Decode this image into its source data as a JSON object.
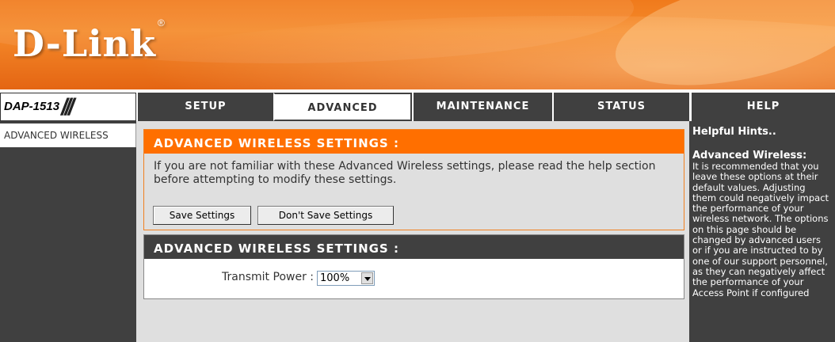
{
  "brand": {
    "logo_text": "D-Link",
    "reg_mark": "®",
    "model": "DAP-1513",
    "model_slashes": "///"
  },
  "nav": {
    "tabs": [
      {
        "label": "SETUP",
        "active": false
      },
      {
        "label": "ADVANCED",
        "active": true
      },
      {
        "label": "MAINTENANCE",
        "active": false
      },
      {
        "label": "STATUS",
        "active": false
      },
      {
        "label": "HELP",
        "active": false
      }
    ]
  },
  "sidebar": {
    "items": [
      {
        "label": "ADVANCED WIRELESS"
      }
    ]
  },
  "main": {
    "section1": {
      "title": "ADVANCED WIRELESS SETTINGS :",
      "description": "If you are not familiar with these Advanced Wireless settings, please read the help section before attempting to modify these settings.",
      "save_button": "Save Settings",
      "dont_save_button": "Don't Save Settings"
    },
    "section2": {
      "title": "ADVANCED WIRELESS SETTINGS :",
      "transmit_power_label": "Transmit Power :",
      "transmit_power_value": "100%"
    }
  },
  "help": {
    "title": "Helpful Hints..",
    "subtitle": "Advanced Wireless:",
    "body": "It is recommended that you leave these options at their default values. Adjusting them could negatively impact the performance of your wireless network. The options on this page should be changed by advanced users or if you are instructed to by one of our support personnel, as they can negatively affect the performance of your Access Point if configured"
  },
  "colors": {
    "accent_orange": "#ff6f00",
    "dark_gray": "#404040",
    "panel_gray": "#dfdfdf"
  }
}
